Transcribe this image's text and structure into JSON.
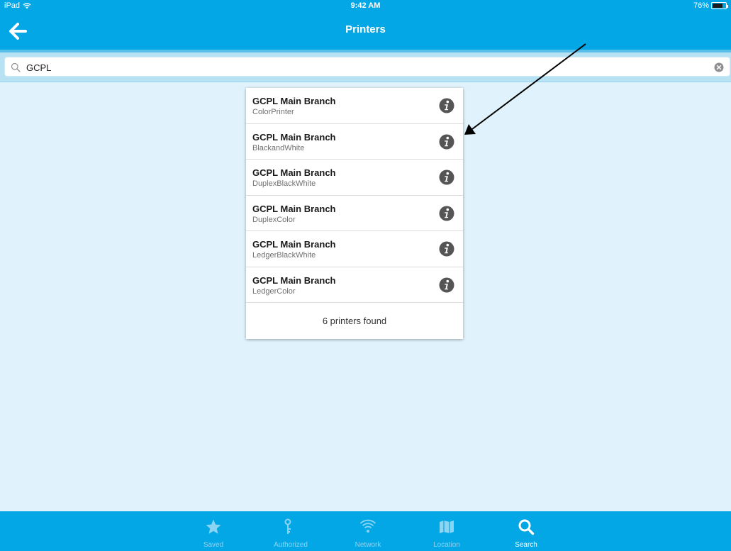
{
  "status_bar": {
    "device": "iPad",
    "wifi_icon": "wifi-icon",
    "time": "9:42 AM",
    "battery_percent": "76%",
    "battery_level": 0.76
  },
  "nav": {
    "back_icon": "arrow-left-icon",
    "title": "Printers"
  },
  "search": {
    "value": "GCPL",
    "search_icon": "magnifier-icon",
    "clear_icon": "clear-circle-icon"
  },
  "results": {
    "items": [
      {
        "name": "GCPL Main Branch",
        "printer": "ColorPrinter"
      },
      {
        "name": "GCPL Main Branch",
        "printer": "BlackandWhite"
      },
      {
        "name": "GCPL Main Branch",
        "printer": "DuplexBlackWhite"
      },
      {
        "name": "GCPL Main Branch",
        "printer": "DuplexColor"
      },
      {
        "name": "GCPL Main Branch",
        "printer": "LedgerBlackWhite"
      },
      {
        "name": "GCPL Main Branch",
        "printer": "LedgerColor"
      }
    ],
    "info_icon": "info-circle-icon",
    "footer": "6 printers found"
  },
  "tabs": [
    {
      "label": "Saved",
      "icon": "star-icon",
      "active": false
    },
    {
      "label": "Authorized",
      "icon": "key-icon",
      "active": false
    },
    {
      "label": "Network",
      "icon": "wifi-icon",
      "active": false
    },
    {
      "label": "Location",
      "icon": "map-icon",
      "active": false
    },
    {
      "label": "Search",
      "icon": "search-icon",
      "active": true
    }
  ],
  "colors": {
    "bar_blue": "#04a7e6",
    "background": "#e0f2fb",
    "inactive_tab": "#8bd4f2",
    "info_icon": "#555555"
  }
}
